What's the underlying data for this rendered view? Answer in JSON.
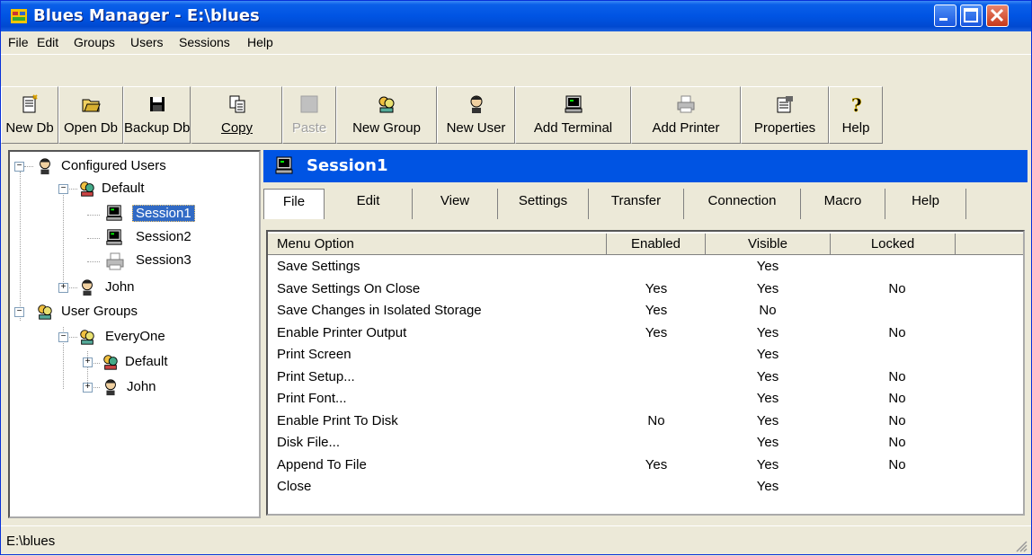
{
  "window": {
    "title": "Blues Manager - E:\\blues"
  },
  "menu": [
    "File",
    "Edit",
    "Groups",
    "Users",
    "Sessions",
    "Help"
  ],
  "toolbar": [
    {
      "label": "New Db",
      "icon": "new-db-icon",
      "enabled": true
    },
    {
      "label": "Open Db",
      "icon": "open-folder-icon",
      "enabled": true
    },
    {
      "label": "Backup Db",
      "icon": "floppy-disk-icon",
      "enabled": true
    },
    {
      "label": "Copy",
      "icon": "copy-icon",
      "enabled": true
    },
    {
      "label": "Paste",
      "icon": "paste-icon",
      "enabled": false
    },
    {
      "label": "New Group",
      "icon": "group-icon",
      "enabled": true
    },
    {
      "label": "New User",
      "icon": "user-icon",
      "enabled": true
    },
    {
      "label": "Add Terminal",
      "icon": "terminal-icon",
      "enabled": true
    },
    {
      "label": "Add Printer",
      "icon": "printer-icon",
      "enabled": true
    },
    {
      "label": "Properties",
      "icon": "properties-icon",
      "enabled": true
    },
    {
      "label": "Help",
      "icon": "help-icon",
      "enabled": true
    }
  ],
  "tree": [
    {
      "label": "Configured Users",
      "icon": "user-icon",
      "expander": "−"
    },
    {
      "label": "Default",
      "icon": "group-icon",
      "expander": "−"
    },
    {
      "label": "Session1",
      "icon": "terminal-icon",
      "selected": true
    },
    {
      "label": "Session2",
      "icon": "terminal-icon"
    },
    {
      "label": "Session3",
      "icon": "printer-icon"
    },
    {
      "label": "John",
      "icon": "user-icon",
      "expander": "+"
    },
    {
      "label": "User Groups",
      "icon": "group-icon",
      "expander": "−"
    },
    {
      "label": "EveryOne",
      "icon": "group-icon",
      "expander": "−"
    },
    {
      "label": "Default",
      "icon": "group-icon",
      "expander": "+"
    },
    {
      "label": "John",
      "icon": "user-icon",
      "expander": "+"
    }
  ],
  "pane": {
    "title": "Session1",
    "icon": "terminal-icon"
  },
  "tabs": [
    "File",
    "Edit",
    "View",
    "Settings",
    "Transfer",
    "Connection",
    "Macro",
    "Help"
  ],
  "active_tab": "File",
  "table": {
    "columns": [
      "Menu Option",
      "Enabled",
      "Visible",
      "Locked"
    ],
    "rows": [
      [
        "Save Settings",
        "",
        "Yes",
        ""
      ],
      [
        "Save Settings On Close",
        "Yes",
        "Yes",
        "No"
      ],
      [
        "Save Changes in Isolated Storage",
        "Yes",
        "No",
        ""
      ],
      [
        "Enable Printer Output",
        "Yes",
        "Yes",
        "No"
      ],
      [
        "Print Screen",
        "",
        "Yes",
        ""
      ],
      [
        "Print Setup...",
        "",
        "Yes",
        "No"
      ],
      [
        "Print Font...",
        "",
        "Yes",
        "No"
      ],
      [
        "Enable Print To Disk",
        "No",
        "Yes",
        "No"
      ],
      [
        "Disk File...",
        "",
        "Yes",
        "No"
      ],
      [
        "Append To File",
        "Yes",
        "Yes",
        "No"
      ],
      [
        "Close",
        "",
        "Yes",
        ""
      ]
    ]
  },
  "status": "E:\\blues"
}
